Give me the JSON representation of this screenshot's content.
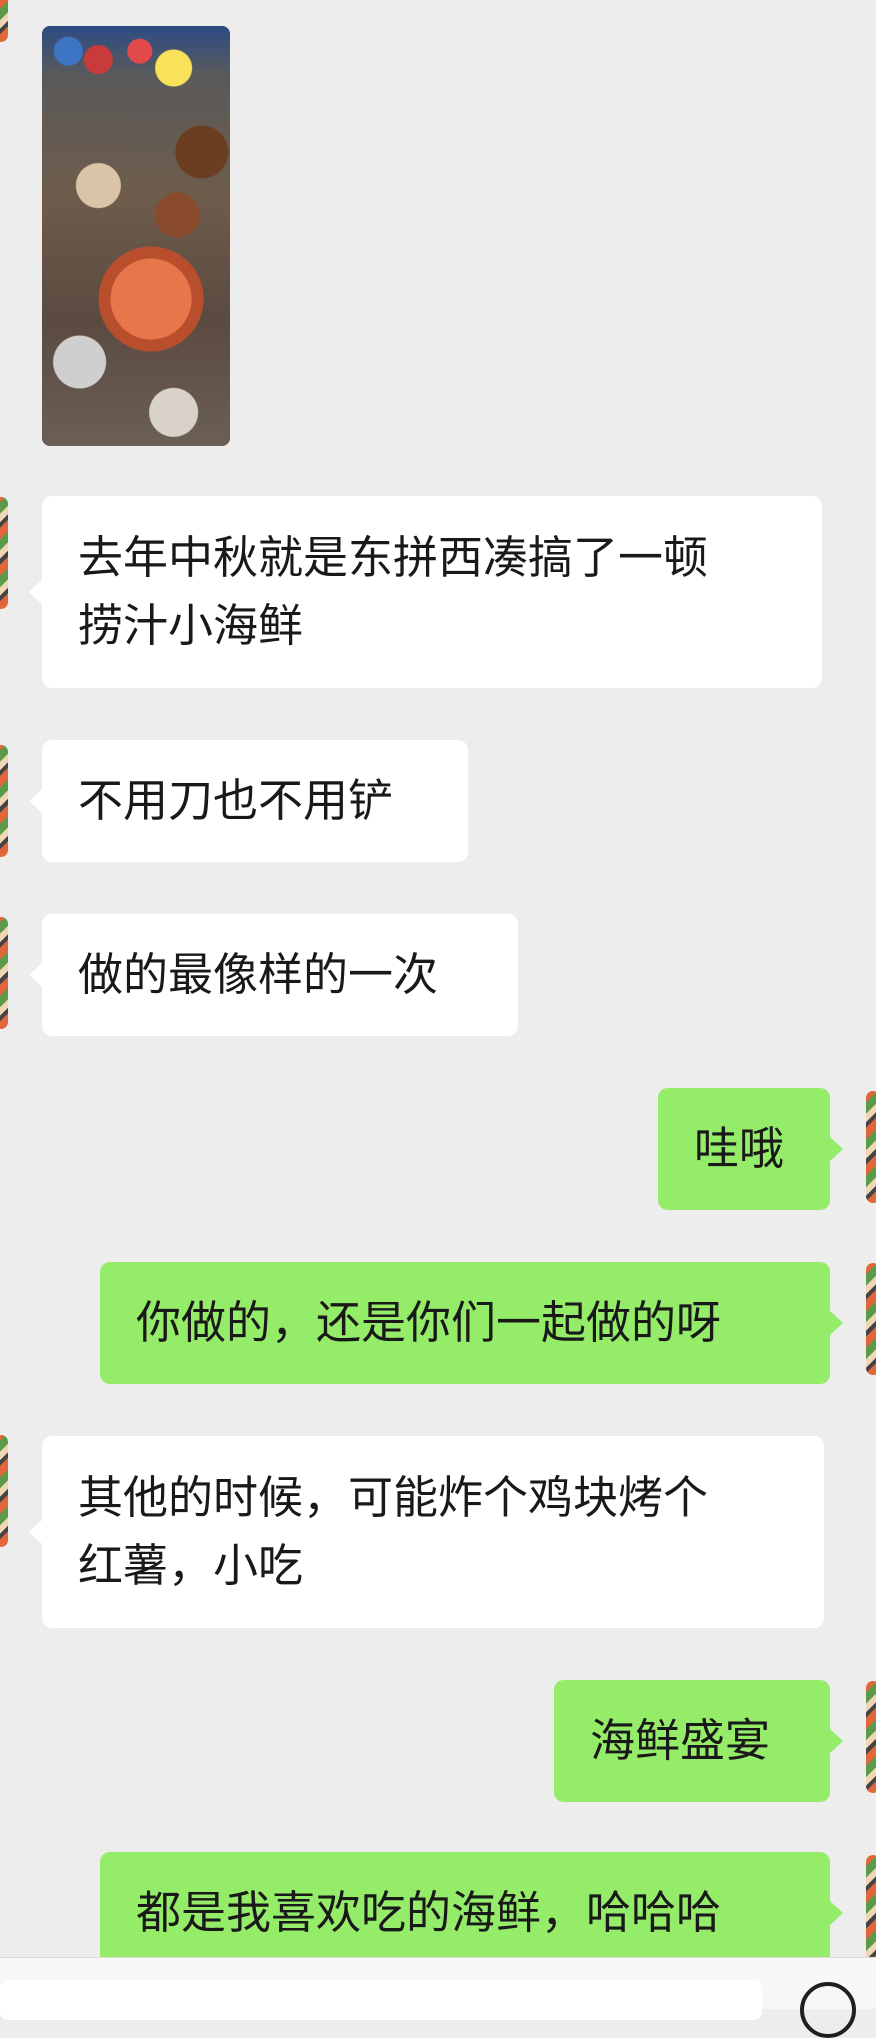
{
  "messages": [
    {
      "side": "in",
      "type": "image"
    },
    {
      "side": "in",
      "text": "去年中秋就是东拼西凑搞了一顿\n捞汁小海鲜"
    },
    {
      "side": "in",
      "text": "不用刀也不用铲"
    },
    {
      "side": "in",
      "text": "做的最像样的一次"
    },
    {
      "side": "out",
      "text": "哇哦"
    },
    {
      "side": "out",
      "text": "你做的，还是你们一起做的呀"
    },
    {
      "side": "in",
      "text": "其他的时候，可能炸个鸡块烤个\n红薯，小吃"
    },
    {
      "side": "out",
      "text": "海鲜盛宴"
    },
    {
      "side": "out",
      "text": "都是我喜欢吃的海鲜，哈哈哈"
    }
  ],
  "colors": {
    "background": "#ededed",
    "incoming_bubble": "#ffffff",
    "outgoing_bubble": "#95ec69"
  },
  "icons": {
    "composer_voice": "voice-icon"
  }
}
